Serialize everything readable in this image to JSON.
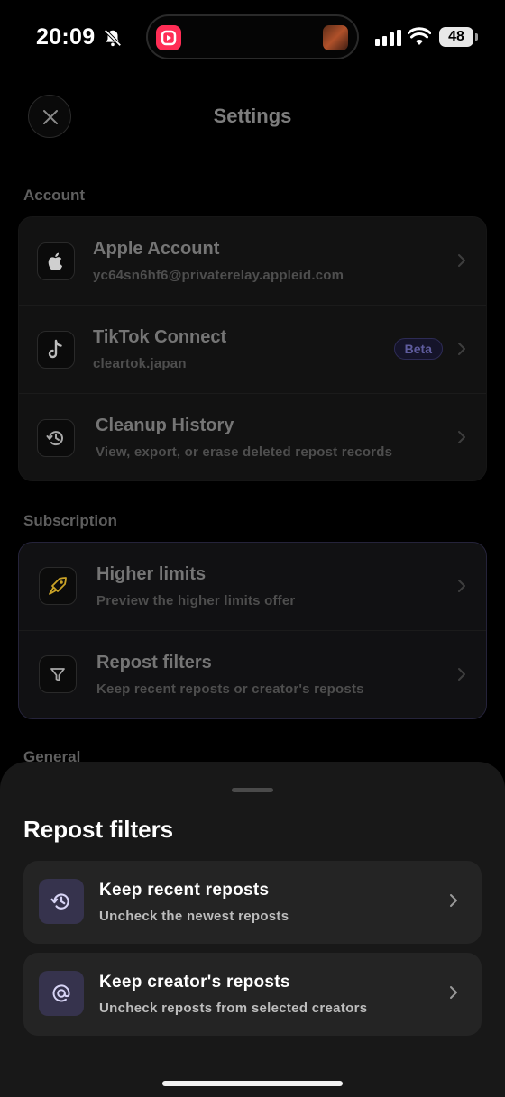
{
  "status_bar": {
    "time": "20:09",
    "battery": "48",
    "icons": [
      "bell-slash-icon",
      "app-icon",
      "album-art",
      "signal-icon",
      "wifi-icon",
      "battery-icon"
    ]
  },
  "header": {
    "title": "Settings",
    "close_icon": "close-icon"
  },
  "sections": {
    "account": {
      "label": "Account",
      "items": [
        {
          "icon": "apple-icon",
          "title": "Apple Account",
          "subtitle": "yc64sn6hf6@privaterelay.appleid.com"
        },
        {
          "icon": "tiktok-icon",
          "title": "TikTok Connect",
          "subtitle": "cleartok.japan",
          "badge": "Beta"
        },
        {
          "icon": "history-icon",
          "title": "Cleanup History",
          "subtitle": "View, export, or erase deleted repost records"
        }
      ]
    },
    "subscription": {
      "label": "Subscription",
      "items": [
        {
          "icon": "rocket-icon",
          "title": "Higher limits",
          "subtitle": "Preview the higher limits offer"
        },
        {
          "icon": "filter-icon",
          "title": "Repost filters",
          "subtitle": "Keep recent reposts or creator's reposts"
        }
      ]
    },
    "general": {
      "label": "General"
    }
  },
  "sheet": {
    "title": "Repost filters",
    "options": [
      {
        "icon": "history-icon",
        "title": "Keep recent reposts",
        "subtitle": "Uncheck the newest reposts"
      },
      {
        "icon": "at-icon",
        "title": "Keep creator's reposts",
        "subtitle": "Uncheck reposts from selected creators"
      }
    ]
  },
  "colors": {
    "background": "#000000",
    "sheet": "#181818",
    "option_bg": "#242424",
    "icon_accent_bg": "#36334d",
    "rocket_accent": "#c9a227",
    "beta_text": "#5f5c9e"
  }
}
